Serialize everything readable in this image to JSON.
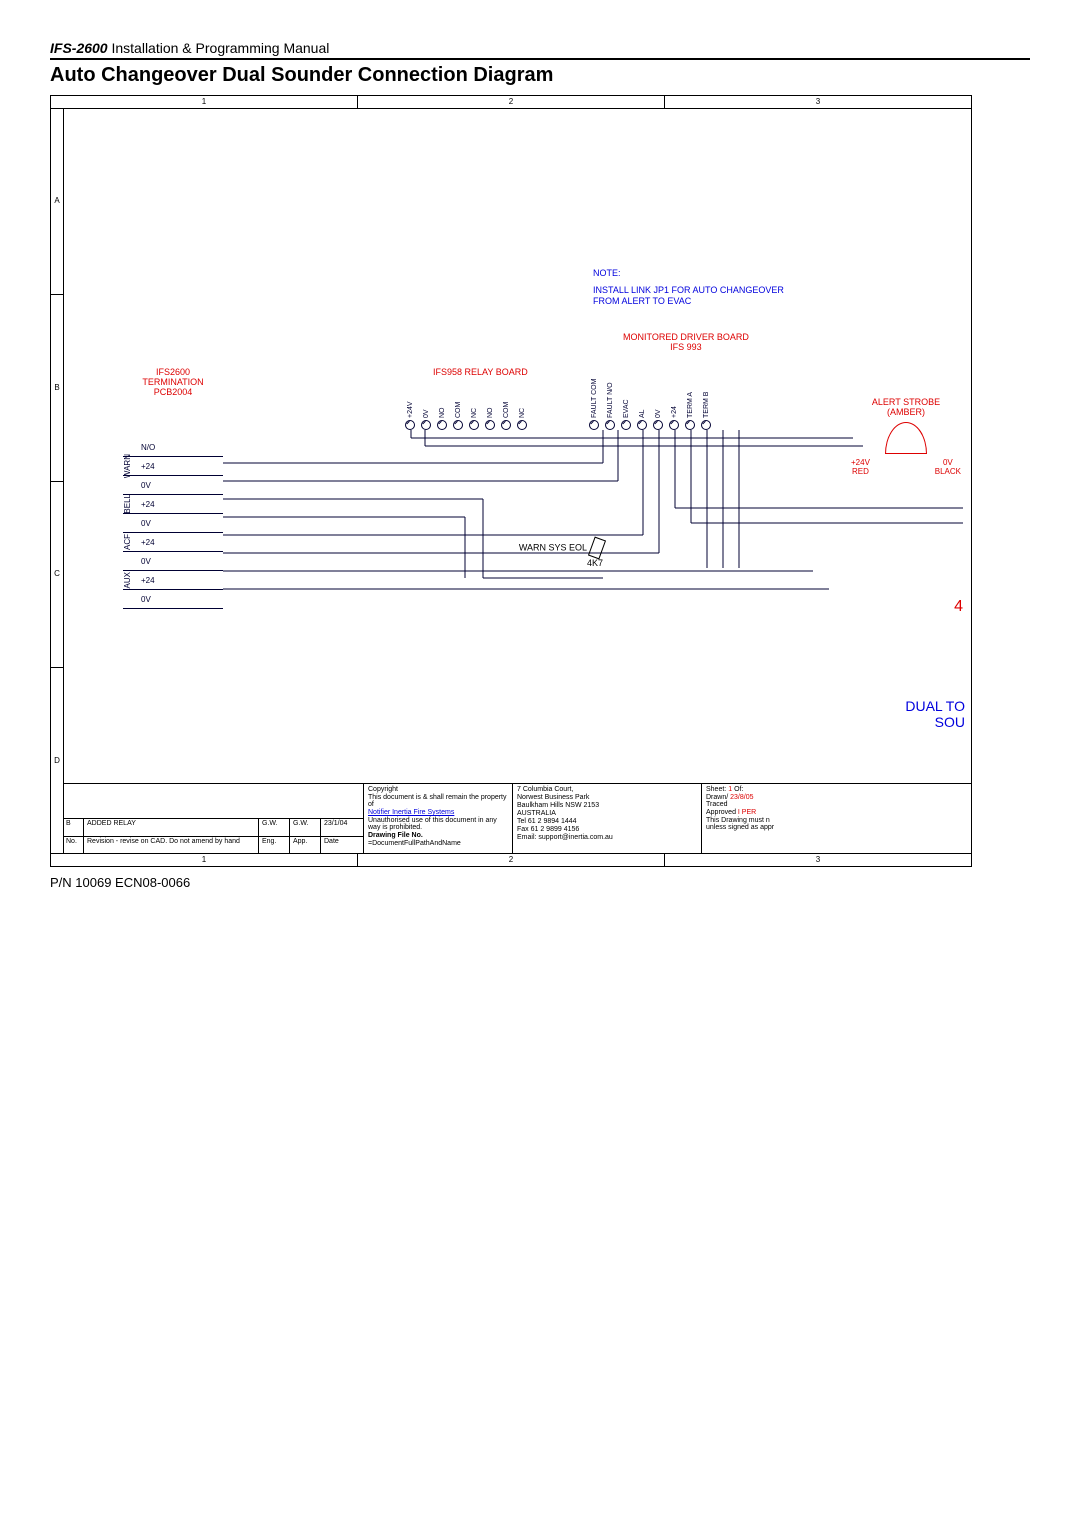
{
  "header": {
    "model": "IFS-2600",
    "title_rest": " Installation & Programming Manual"
  },
  "section_title": "Auto Changeover Dual Sounder Connection Diagram",
  "ruler_cols": [
    "1",
    "2",
    "3"
  ],
  "ruler_rows": [
    "A",
    "B",
    "C",
    "D"
  ],
  "note": {
    "heading": "NOTE:",
    "line": "INSTALL LINK JP1 FOR AUTO CHANGEOVER FROM ALERT TO EVAC"
  },
  "driver_label": {
    "l1": "MONITORED DRIVER BOARD",
    "l2": "IFS 993"
  },
  "relay_label": "IFS958 RELAY BOARD",
  "term_header": {
    "l1": "IFS2600",
    "l2": "TERMINATION",
    "l3": "PCB2004"
  },
  "term_rows": [
    {
      "group": "",
      "sub": "N/O"
    },
    {
      "group": "WARN",
      "sub": "+24"
    },
    {
      "group": "",
      "sub": "0V"
    },
    {
      "group": "BELL",
      "sub": "+24"
    },
    {
      "group": "",
      "sub": "0V"
    },
    {
      "group": "ACF",
      "sub": "+24"
    },
    {
      "group": "",
      "sub": "0V"
    },
    {
      "group": "AUX",
      "sub": "+24"
    },
    {
      "group": "",
      "sub": "0V"
    }
  ],
  "relay_pins": [
    "+24V",
    "0V",
    "NO",
    "COM",
    "NC",
    "NO",
    "COM",
    "NC"
  ],
  "driver_pins": [
    "FAULT COM",
    "FAULT N/O",
    "EVAC",
    "AL",
    "0V",
    "+24",
    "TERM A",
    "TERM B"
  ],
  "strobe": {
    "title": "ALERT STROBE",
    "sub": "(AMBER)",
    "pos_v": "+24V",
    "pos_c": "RED",
    "neg_v": "0V",
    "neg_c": "BLACK"
  },
  "eol": {
    "l1": "WARN SYS EOL",
    "l2": "4K7"
  },
  "big4": "4",
  "dual_to": {
    "l1": "DUAL TO",
    "l2": "SOU"
  },
  "titleblock": {
    "rev_body": {
      "no": "B",
      "desc": "ADDED RELAY",
      "eng": "G.W.",
      "app": "G.W.",
      "date": "23/1/04"
    },
    "rev_head": {
      "no": "No.",
      "desc": "Revision - revise on CAD.  Do not amend by hand",
      "eng": "Eng.",
      "app": "App.",
      "date": "Date"
    },
    "copyright": {
      "c1": "Copyright",
      "c2": "This document is & shall remain the property of",
      "c3": "Notifier Inertia Fire Systems",
      "c4": "Unauthorised use of this document in any way is prohibited.",
      "file_label": "Drawing File No.",
      "file_val": "=DocumentFullPathAndName"
    },
    "address": {
      "l1": "7 Columbia Court,",
      "l2": "Norwest Business Park",
      "l3": "Baulkham Hills NSW 2153",
      "l4": "AUSTRALIA",
      "l5": "Tel  61 2 9894 1444",
      "l6": "Fax  61 2 9899 4156",
      "l7": "Email: support@inertia.com.au"
    },
    "meta": {
      "sheet_l": "Sheet:",
      "sheet_n": "1",
      "of": "Of:",
      "drawn_l": "Drawn/",
      "traced": "Traced",
      "drawn_d": "23/8/05",
      "appr_l": "Approved",
      "appr_v": "I PER",
      "note": "This Drawing must n",
      "note2": "unless signed as appr"
    }
  },
  "footer": "P/N 10069 ECN08-0066"
}
